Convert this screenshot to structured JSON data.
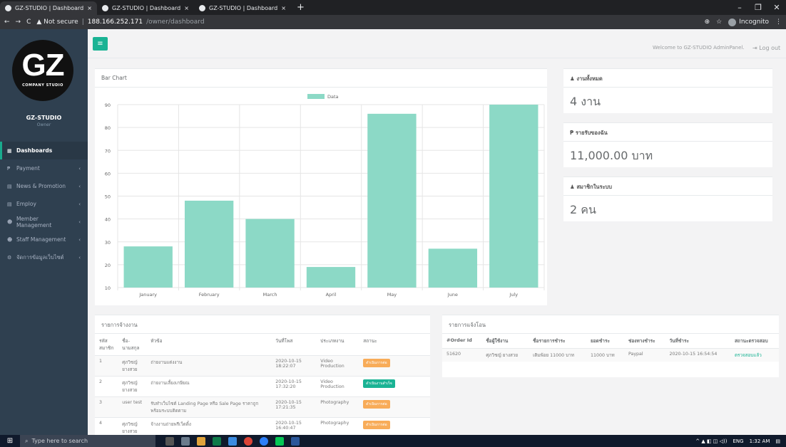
{
  "browser": {
    "tabs": [
      {
        "title": "GZ-STUDIO | Dashboard",
        "close": "×"
      },
      {
        "title": "GZ-STUDIO | Dashboard",
        "close": "×"
      },
      {
        "title": "GZ-STUDIO | Dashboard",
        "close": "×"
      }
    ],
    "new_tab": "+",
    "min": "–",
    "max": "❐",
    "close": "✕",
    "back": "←",
    "forward": "→",
    "reload": "C",
    "security": "▲ Not secure",
    "url_host": "188.166.252.171",
    "url_path": "/owner/dashboard",
    "incognito": "Incognito",
    "star": "☆",
    "zoom": "⊕",
    "menu": "⋮"
  },
  "sidebar": {
    "logo_big": "GZ",
    "logo_small": "COMPANY STUDIO",
    "name": "GZ-STUDIO",
    "role": "Owner",
    "items": [
      {
        "label": "Dashboards",
        "icon": "▦",
        "caret": ""
      },
      {
        "label": "Payment",
        "icon": "₱",
        "caret": "‹"
      },
      {
        "label": "News & Promotion",
        "icon": "▤",
        "caret": "‹"
      },
      {
        "label": "Employ",
        "icon": "▤",
        "caret": "‹"
      },
      {
        "label": "Member Management",
        "icon": "☻",
        "caret": "‹"
      },
      {
        "label": "Staff Management",
        "icon": "☻",
        "caret": "‹"
      },
      {
        "label": "จัดการข้อมูลเว็บไซต์",
        "icon": "⚙",
        "caret": "‹"
      }
    ]
  },
  "topbar": {
    "menu_icon": "≡",
    "welcome": "Welcome to GZ-STUDIO AdminPanel.",
    "logout": "⇥ Log out"
  },
  "chart_panel": {
    "title": "Bar Chart"
  },
  "chart_data": {
    "type": "bar",
    "categories": [
      "January",
      "February",
      "March",
      "April",
      "May",
      "June",
      "July"
    ],
    "series": [
      {
        "name": "Data",
        "values": [
          28,
          48,
          40,
          19,
          86,
          27,
          90
        ]
      }
    ],
    "ylim": [
      10,
      90
    ],
    "yticks": [
      10,
      20,
      30,
      40,
      50,
      60,
      70,
      80,
      90
    ],
    "grid": true,
    "legend": "top",
    "color": "#8cd9c6"
  },
  "stats": [
    {
      "title": "♟ งานทั้งหมด",
      "value": "4 งาน"
    },
    {
      "title": "₱ รายรับของฉัน",
      "value": "11,000.00 บาท"
    },
    {
      "title": "♟ สมาชิกในระบบ",
      "value": "2 คน"
    }
  ],
  "jobs": {
    "title": "รายการจ้างงาน",
    "headers": [
      "รหัสสมาชิก",
      "ชื่อ-นามสกุล",
      "หัวข้อ",
      "วันที่โพส",
      "ประเภทงาน",
      "สถานะ"
    ],
    "rows": [
      {
        "id": "1",
        "name": "ศุภวิชญ์ ยางสวย",
        "topic": "ถ่ายงานแต่งงาน",
        "date": "2020-10-15 18:22:07",
        "type": "Video Production",
        "status": "ดำเนินการต่อ"
      },
      {
        "id": "2",
        "name": "ศุภวิชญ์ ยางสวย",
        "topic": "ถ่ายงานเลี้ยงเกษียณ",
        "date": "2020-10-15 17:32:20",
        "type": "Video Production",
        "status": "ดำเนินงานสำเร็จ"
      },
      {
        "id": "3",
        "name": "user test",
        "topic": "รับทำเว็บไซต์ Landing Page หรือ Sale Page ราคาถูกพร้อมระบบติดตาม",
        "date": "2020-10-15 17:21:35",
        "type": "Photography",
        "status": "ดำเนินการต่อ"
      },
      {
        "id": "4",
        "name": "ศุภวิชญ์ ยางสวย",
        "topic": "จ้างงานถ่ายพรีเว็ดดิ้ง",
        "date": "2020-10-15 16:40:47",
        "type": "Photography",
        "status": "ดำเนินการต่อ"
      }
    ]
  },
  "payments": {
    "title": "รายการแจ้งโอน",
    "headers": [
      "#Order Id",
      "ชื่อผู้ใช้งาน",
      "ชื่อรายการชำระ",
      "ยอดชำระ",
      "ช่องทางชำระ",
      "วันที่ชำระ",
      "สถานะตรวจสอบ"
    ],
    "rows": [
      {
        "order": "51620",
        "user": "ศุภวิชญ์ ยางสวย",
        "item": "เติมพ้อย 11000 บาท",
        "amount": "11000 บาท",
        "channel": "Paypal",
        "date": "2020-10-15 16:54:54",
        "status": "ตรวจสอบแล้ว"
      }
    ]
  },
  "taskbar": {
    "start": "⊞",
    "search": "Type here to search",
    "lang": "ENG",
    "time": "1:32 AM",
    "tray": "^ ▲ ◧ ◫ ◁))"
  }
}
